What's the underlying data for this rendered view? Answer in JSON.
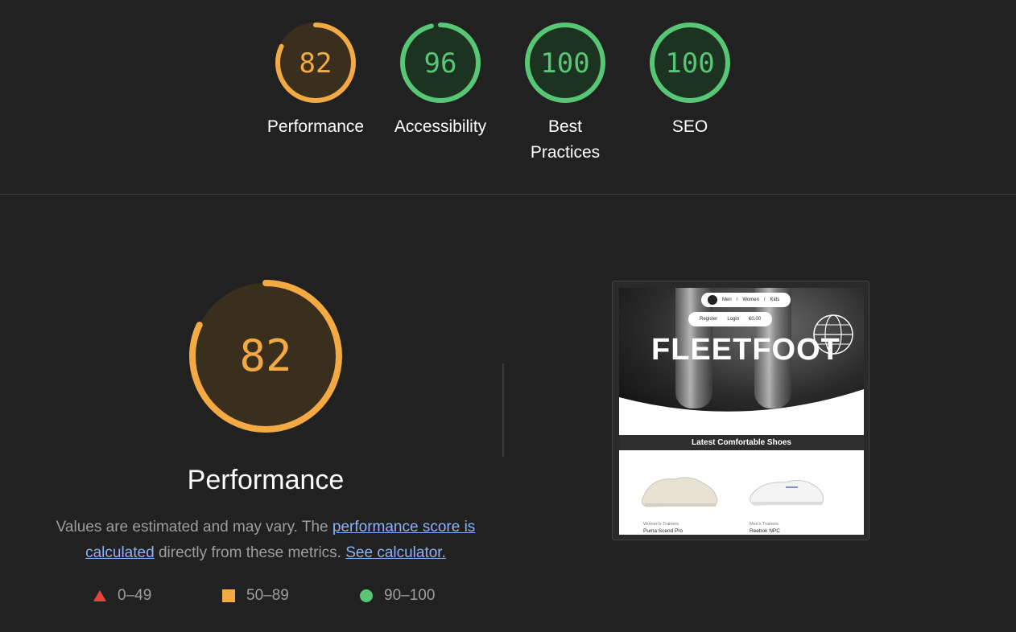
{
  "colors": {
    "orange": "#f4aa42",
    "green": "#58c775",
    "red": "#e2473c",
    "background": "#212121"
  },
  "summary": {
    "gauges": [
      {
        "score": 82,
        "label": "Performance",
        "color": "orange"
      },
      {
        "score": 96,
        "label": "Accessibility",
        "color": "green"
      },
      {
        "score": 100,
        "label": "Best\nPractices",
        "color": "green"
      },
      {
        "score": 100,
        "label": "SEO",
        "color": "green"
      }
    ]
  },
  "performance": {
    "score": 82,
    "title": "Performance",
    "desc_prefix": "Values are estimated and may vary. The ",
    "desc_link1": "performance score is calculated",
    "desc_mid": " directly from these metrics. ",
    "desc_link2": "See calculator."
  },
  "legend": [
    {
      "shape": "triangle",
      "range": "0–49",
      "color": "red"
    },
    {
      "shape": "square",
      "range": "50–89",
      "color": "orange"
    },
    {
      "shape": "circle",
      "range": "90–100",
      "color": "green"
    }
  ],
  "screenshot": {
    "nav": [
      "Men",
      "Women",
      "Kids"
    ],
    "actions": [
      "Register",
      "Login",
      "€0.00"
    ],
    "logo": "FLEETFOOT",
    "band": "Latest Comfortable Shoes",
    "products": [
      {
        "category": "Women's Trainers",
        "name": "Puma Scend Pro"
      },
      {
        "category": "Men's Trainers",
        "name": "Reebok NPC"
      }
    ]
  }
}
